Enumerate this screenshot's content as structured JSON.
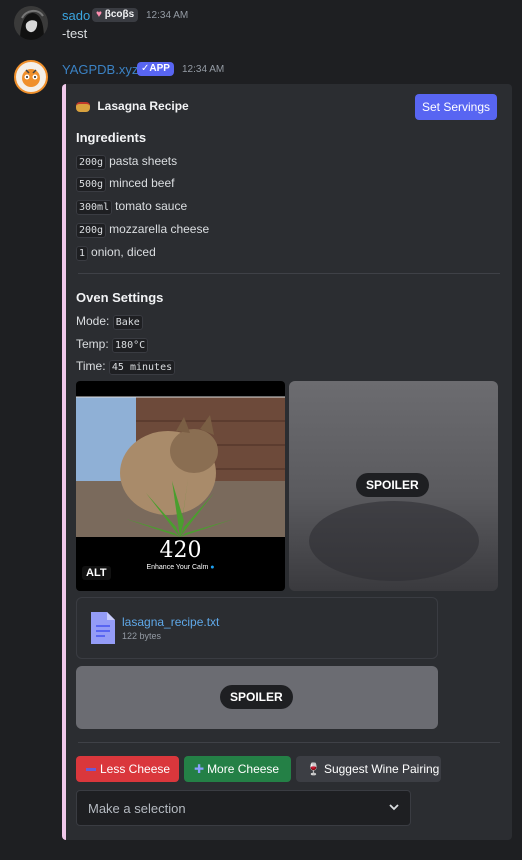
{
  "message1": {
    "username": "sado",
    "tag": "βcoβs",
    "timestamp": "12:34 AM",
    "text": "-test"
  },
  "message2": {
    "username": "YAGPDB.xyz",
    "app_badge": "APP",
    "timestamp": "12:34 AM"
  },
  "embed": {
    "title": "Lasagna Recipe",
    "set_servings_label": "Set Servings",
    "ingredients_heading": "Ingredients",
    "ingredients": [
      {
        "qty": "200g",
        "item": "pasta sheets"
      },
      {
        "qty": "500g",
        "item": "minced beef"
      },
      {
        "qty": "300ml",
        "item": "tomato sauce"
      },
      {
        "qty": "200g",
        "item": "mozzarella cheese"
      },
      {
        "qty": "1",
        "item": "onion, diced"
      }
    ],
    "oven_heading": "Oven Settings",
    "oven": {
      "mode_label": "Mode:",
      "mode_value": "Bake",
      "temp_label": "Temp:",
      "temp_value": "180°C",
      "time_label": "Time:",
      "time_value": "45 minutes"
    },
    "image1": {
      "number": "420",
      "caption": "Enhance Your Calm",
      "alt_badge": "ALT"
    },
    "image2": {
      "spoiler_label": "SPOILER"
    },
    "file": {
      "name": "lasagna_recipe.txt",
      "size": "122 bytes"
    },
    "spoiler_block_label": "SPOILER",
    "buttons": {
      "less": "Less Cheese",
      "more": "More Cheese",
      "wine": "Suggest Wine Pairing"
    },
    "select_placeholder": "Make a selection"
  },
  "colors": {
    "username1": "#3ba5e0",
    "username2": "#3b82c4",
    "accent": "#5865f2",
    "danger": "#da373c",
    "success": "#248046",
    "embed_border": "#f0c8ea"
  }
}
